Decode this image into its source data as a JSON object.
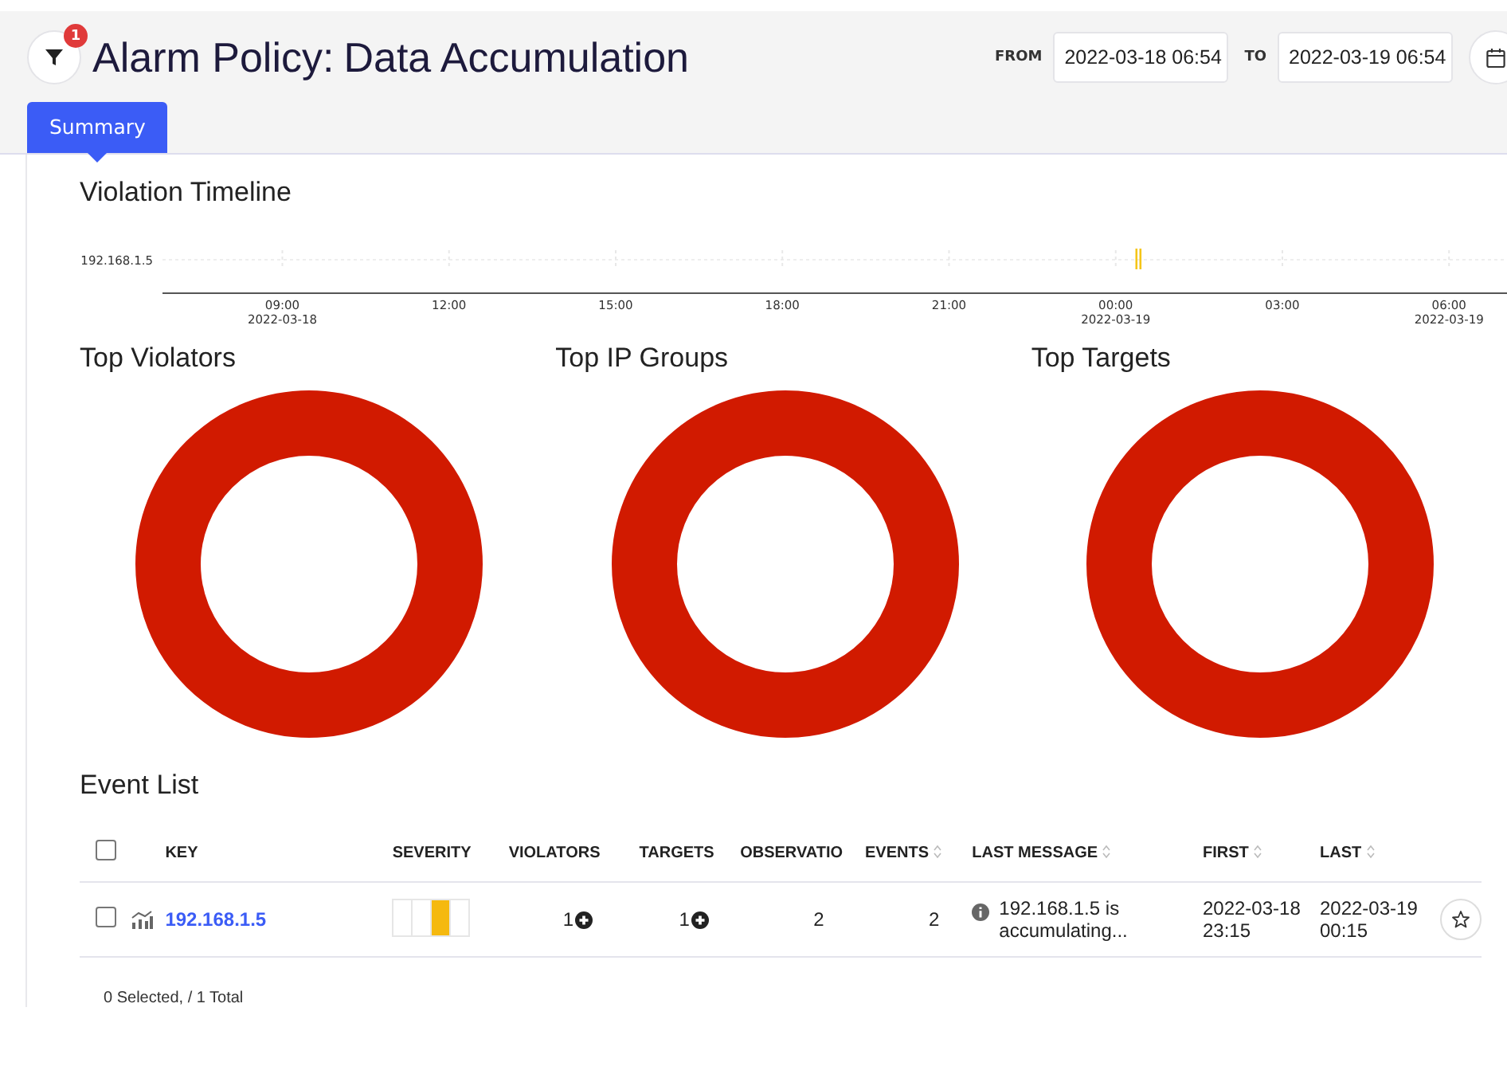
{
  "header": {
    "filter_badge": "1",
    "title": "Alarm Policy:",
    "subtitle": "Data Accumulation",
    "from_label": "FROM",
    "from_value": "2022-03-18 06:54",
    "to_label": "TO",
    "to_value": "2022-03-19 06:54"
  },
  "tabs": [
    {
      "label": "Summary",
      "selected": true
    }
  ],
  "timeline": {
    "title": "Violation Timeline",
    "ticks": [
      {
        "time": "09:00",
        "date": "2022-03-18"
      },
      {
        "time": "12:00"
      },
      {
        "time": "15:00"
      },
      {
        "time": "18:00"
      },
      {
        "time": "21:00"
      },
      {
        "time": "00:00",
        "date": "2022-03-19"
      },
      {
        "time": "03:00"
      },
      {
        "time": "06:00",
        "date": "2022-03-19"
      }
    ],
    "rows": [
      {
        "label": "192.168.1.5",
        "events": [
          {
            "level": 0.728
          },
          {
            "level": 0.731
          }
        ]
      }
    ]
  },
  "donuts": [
    {
      "title": "Top Violators"
    },
    {
      "title": "Top IP Groups"
    },
    {
      "title": "Top Targets"
    }
  ],
  "event_list": {
    "title": "Event List",
    "select_all_checked": false,
    "columns": [
      {
        "label": "KEY",
        "sortable": false
      },
      {
        "label": "SEVERITY",
        "sortable": false
      },
      {
        "label": "VIOLATORS",
        "sortable": false
      },
      {
        "label": "TARGETS",
        "sortable": false
      },
      {
        "label": "OBSERVATIO",
        "sortable": false
      },
      {
        "label": "EVENTS",
        "sortable": true
      },
      {
        "label": "LAST MESSAGE",
        "sortable": true
      },
      {
        "label": "FIRST",
        "sortable": true
      },
      {
        "label": "LAST",
        "sortable": true
      }
    ],
    "rows": [
      {
        "checked": false,
        "key": "192.168.1.5",
        "severity": [
          {
            "on": false
          },
          {
            "on": false
          },
          {
            "on": true
          },
          {
            "on": false
          }
        ],
        "violators": "1",
        "targets": "1",
        "observations": "2",
        "events": "2",
        "last_message": "192.168.1.5 is accumulating...",
        "first": "2022-03-18 23:15",
        "last": "2022-03-19 00:15"
      }
    ],
    "footer": "0 Selected, / 1 Total"
  }
}
